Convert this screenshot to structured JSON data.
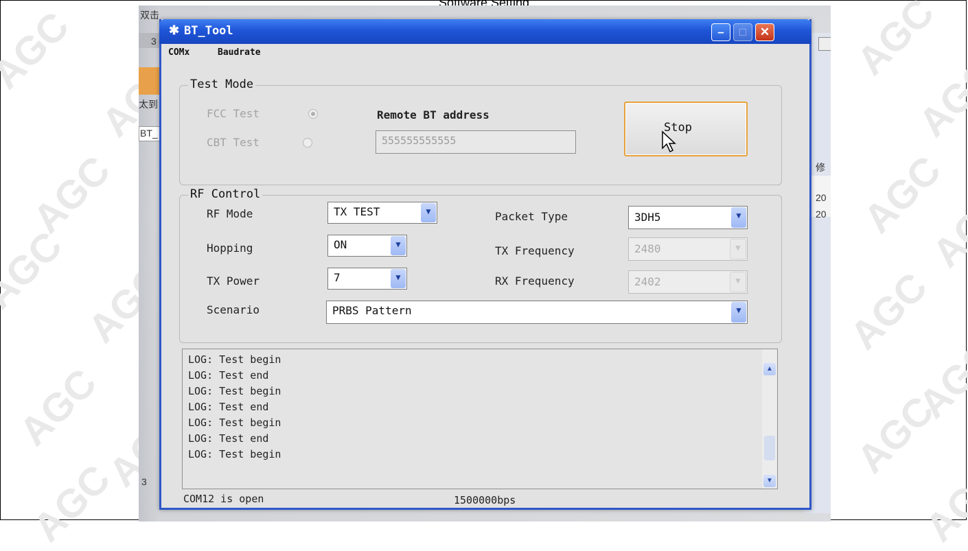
{
  "page": {
    "heading": "Software Setting",
    "watermark": "AGC"
  },
  "background_window": {
    "fragments": [
      "双击",
      "3",
      "太到",
      "BT_",
      "修",
      "20",
      "20",
      "3"
    ]
  },
  "window": {
    "title": "BT_Tool",
    "title_icon": "bluetooth-icon",
    "buttons": {
      "minimize": "–",
      "maximize": "□",
      "close": "✕"
    },
    "menu": [
      "COMx",
      "Baudrate"
    ]
  },
  "test_mode": {
    "legend": "Test Mode",
    "fcc_label": "FCC Test",
    "fcc_selected": true,
    "cbt_label": "CBT Test",
    "cbt_selected": false,
    "remote_label": "Remote BT address",
    "remote_value": "555555555555",
    "stop_label": "Stop"
  },
  "rf_control": {
    "legend": "RF Control",
    "rf_mode_label": "RF Mode",
    "rf_mode_value": "TX TEST",
    "hopping_label": "Hopping",
    "hopping_value": "ON",
    "tx_power_label": "TX Power",
    "tx_power_value": "7",
    "scenario_label": "Scenario",
    "scenario_value": "PRBS Pattern",
    "packet_type_label": "Packet Type",
    "packet_type_value": "3DH5",
    "tx_freq_label": "TX Frequency",
    "tx_freq_value": "2480",
    "rx_freq_label": "RX Frequency",
    "rx_freq_value": "2402"
  },
  "log": {
    "lines": [
      "LOG: Test begin",
      "LOG: Test end",
      "LOG: Test begin",
      "LOG: Test end",
      "LOG: Test begin",
      "LOG: Test end",
      "LOG: Test begin"
    ]
  },
  "status": {
    "port": "COM12 is open",
    "baud": "1500000bps"
  }
}
